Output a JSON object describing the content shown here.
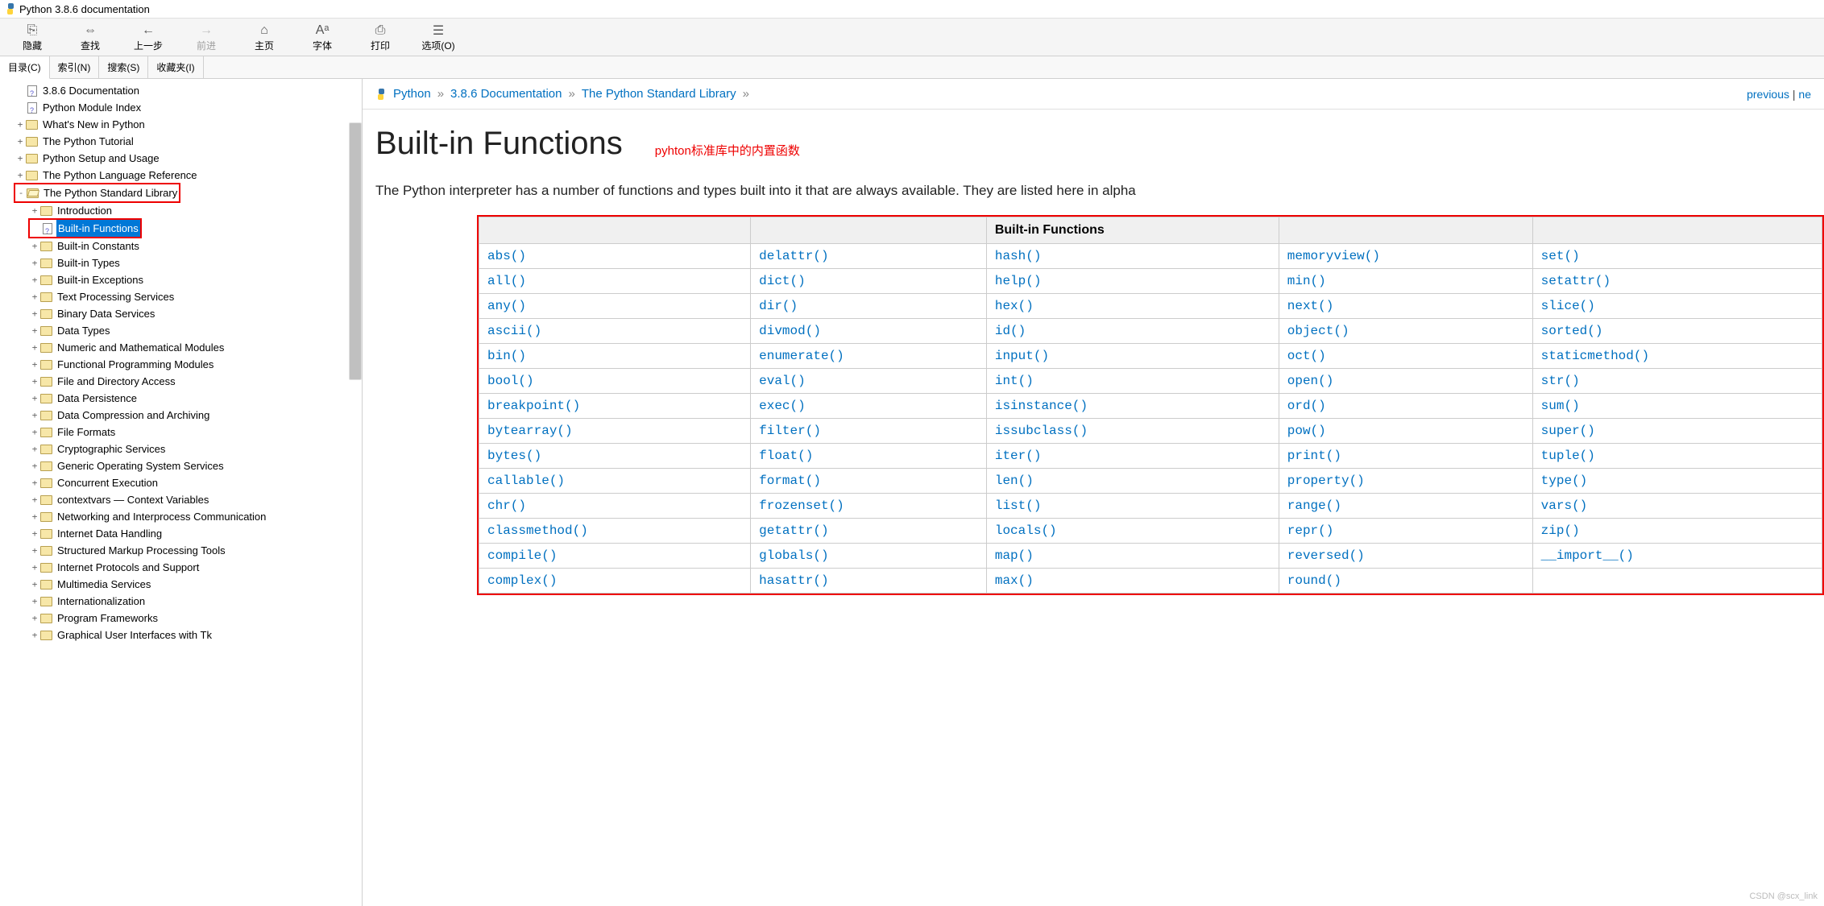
{
  "window": {
    "title": "Python 3.8.6 documentation"
  },
  "toolbar": [
    {
      "name": "hide",
      "icon": "⎘",
      "label": "隐藏",
      "disabled": false
    },
    {
      "name": "find",
      "icon": "⇔",
      "label": "查找",
      "disabled": false
    },
    {
      "name": "back",
      "icon": "←",
      "label": "上一步",
      "disabled": false
    },
    {
      "name": "forward",
      "icon": "→",
      "label": "前进",
      "disabled": true
    },
    {
      "name": "home",
      "icon": "⌂",
      "label": "主页",
      "disabled": false
    },
    {
      "name": "font",
      "icon": "Aᵃ",
      "label": "字体",
      "disabled": false
    },
    {
      "name": "print",
      "icon": "⎙",
      "label": "打印",
      "disabled": false
    },
    {
      "name": "options",
      "icon": "☰",
      "label": "选项(O)",
      "disabled": false
    }
  ],
  "tabs": [
    {
      "name": "contents",
      "label": "目录(C)",
      "active": true
    },
    {
      "name": "index",
      "label": "索引(N)",
      "active": false
    },
    {
      "name": "search",
      "label": "搜索(S)",
      "active": false
    },
    {
      "name": "favorites",
      "label": "收藏夹(I)",
      "active": false
    }
  ],
  "tree": [
    {
      "level": 1,
      "type": "doc",
      "exp": "",
      "label": "3.8.6 Documentation"
    },
    {
      "level": 1,
      "type": "doc",
      "exp": "",
      "label": "Python Module Index"
    },
    {
      "level": 1,
      "type": "closed",
      "exp": "+",
      "label": "What's New in Python"
    },
    {
      "level": 1,
      "type": "closed",
      "exp": "+",
      "label": "The Python Tutorial"
    },
    {
      "level": 1,
      "type": "closed",
      "exp": "+",
      "label": "Python Setup and Usage"
    },
    {
      "level": 1,
      "type": "closed",
      "exp": "+",
      "label": "The Python Language Reference"
    },
    {
      "level": 1,
      "type": "open",
      "exp": "-",
      "label": "The Python Standard Library",
      "red": true
    },
    {
      "level": 2,
      "type": "closed",
      "exp": "+",
      "label": "Introduction"
    },
    {
      "level": 2,
      "type": "doc",
      "exp": "",
      "label": "Built-in Functions",
      "selected": true,
      "red": true
    },
    {
      "level": 2,
      "type": "closed",
      "exp": "+",
      "label": "Built-in Constants"
    },
    {
      "level": 2,
      "type": "closed",
      "exp": "+",
      "label": "Built-in Types"
    },
    {
      "level": 2,
      "type": "closed",
      "exp": "+",
      "label": "Built-in Exceptions"
    },
    {
      "level": 2,
      "type": "closed",
      "exp": "+",
      "label": "Text Processing Services"
    },
    {
      "level": 2,
      "type": "closed",
      "exp": "+",
      "label": "Binary Data Services"
    },
    {
      "level": 2,
      "type": "closed",
      "exp": "+",
      "label": "Data Types"
    },
    {
      "level": 2,
      "type": "closed",
      "exp": "+",
      "label": "Numeric and Mathematical Modules"
    },
    {
      "level": 2,
      "type": "closed",
      "exp": "+",
      "label": "Functional Programming Modules"
    },
    {
      "level": 2,
      "type": "closed",
      "exp": "+",
      "label": "File and Directory Access"
    },
    {
      "level": 2,
      "type": "closed",
      "exp": "+",
      "label": "Data Persistence"
    },
    {
      "level": 2,
      "type": "closed",
      "exp": "+",
      "label": "Data Compression and Archiving"
    },
    {
      "level": 2,
      "type": "closed",
      "exp": "+",
      "label": "File Formats"
    },
    {
      "level": 2,
      "type": "closed",
      "exp": "+",
      "label": "Cryptographic Services"
    },
    {
      "level": 2,
      "type": "closed",
      "exp": "+",
      "label": "Generic Operating System Services"
    },
    {
      "level": 2,
      "type": "closed",
      "exp": "+",
      "label": "Concurrent Execution"
    },
    {
      "level": 2,
      "type": "closed",
      "exp": "+",
      "label": "contextvars — Context Variables"
    },
    {
      "level": 2,
      "type": "closed",
      "exp": "+",
      "label": "Networking and Interprocess Communication"
    },
    {
      "level": 2,
      "type": "closed",
      "exp": "+",
      "label": "Internet Data Handling"
    },
    {
      "level": 2,
      "type": "closed",
      "exp": "+",
      "label": "Structured Markup Processing Tools"
    },
    {
      "level": 2,
      "type": "closed",
      "exp": "+",
      "label": "Internet Protocols and Support"
    },
    {
      "level": 2,
      "type": "closed",
      "exp": "+",
      "label": "Multimedia Services"
    },
    {
      "level": 2,
      "type": "closed",
      "exp": "+",
      "label": "Internationalization"
    },
    {
      "level": 2,
      "type": "closed",
      "exp": "+",
      "label": "Program Frameworks"
    },
    {
      "level": 2,
      "type": "closed",
      "exp": "+",
      "label": "Graphical User Interfaces with Tk"
    }
  ],
  "breadcrumb": {
    "parts": [
      "Python",
      "3.8.6 Documentation",
      "The Python Standard Library"
    ],
    "sep": "»",
    "prev": "previous",
    "divider": "|",
    "next": "ne"
  },
  "page": {
    "heading": "Built-in Functions",
    "annotation": "pyhton标准库中的内置函数",
    "intro": "The Python interpreter has a number of functions and types built into it that are always available. They are listed here in alpha",
    "table_header": "Built-in Functions",
    "functions": [
      [
        "abs()",
        "delattr()",
        "hash()",
        "memoryview()",
        "set()"
      ],
      [
        "all()",
        "dict()",
        "help()",
        "min()",
        "setattr()"
      ],
      [
        "any()",
        "dir()",
        "hex()",
        "next()",
        "slice()"
      ],
      [
        "ascii()",
        "divmod()",
        "id()",
        "object()",
        "sorted()"
      ],
      [
        "bin()",
        "enumerate()",
        "input()",
        "oct()",
        "staticmethod()"
      ],
      [
        "bool()",
        "eval()",
        "int()",
        "open()",
        "str()"
      ],
      [
        "breakpoint()",
        "exec()",
        "isinstance()",
        "ord()",
        "sum()"
      ],
      [
        "bytearray()",
        "filter()",
        "issubclass()",
        "pow()",
        "super()"
      ],
      [
        "bytes()",
        "float()",
        "iter()",
        "print()",
        "tuple()"
      ],
      [
        "callable()",
        "format()",
        "len()",
        "property()",
        "type()"
      ],
      [
        "chr()",
        "frozenset()",
        "list()",
        "range()",
        "vars()"
      ],
      [
        "classmethod()",
        "getattr()",
        "locals()",
        "repr()",
        "zip()"
      ],
      [
        "compile()",
        "globals()",
        "map()",
        "reversed()",
        "__import__()"
      ],
      [
        "complex()",
        "hasattr()",
        "max()",
        "round()",
        ""
      ]
    ]
  },
  "watermark": "CSDN @scx_link"
}
